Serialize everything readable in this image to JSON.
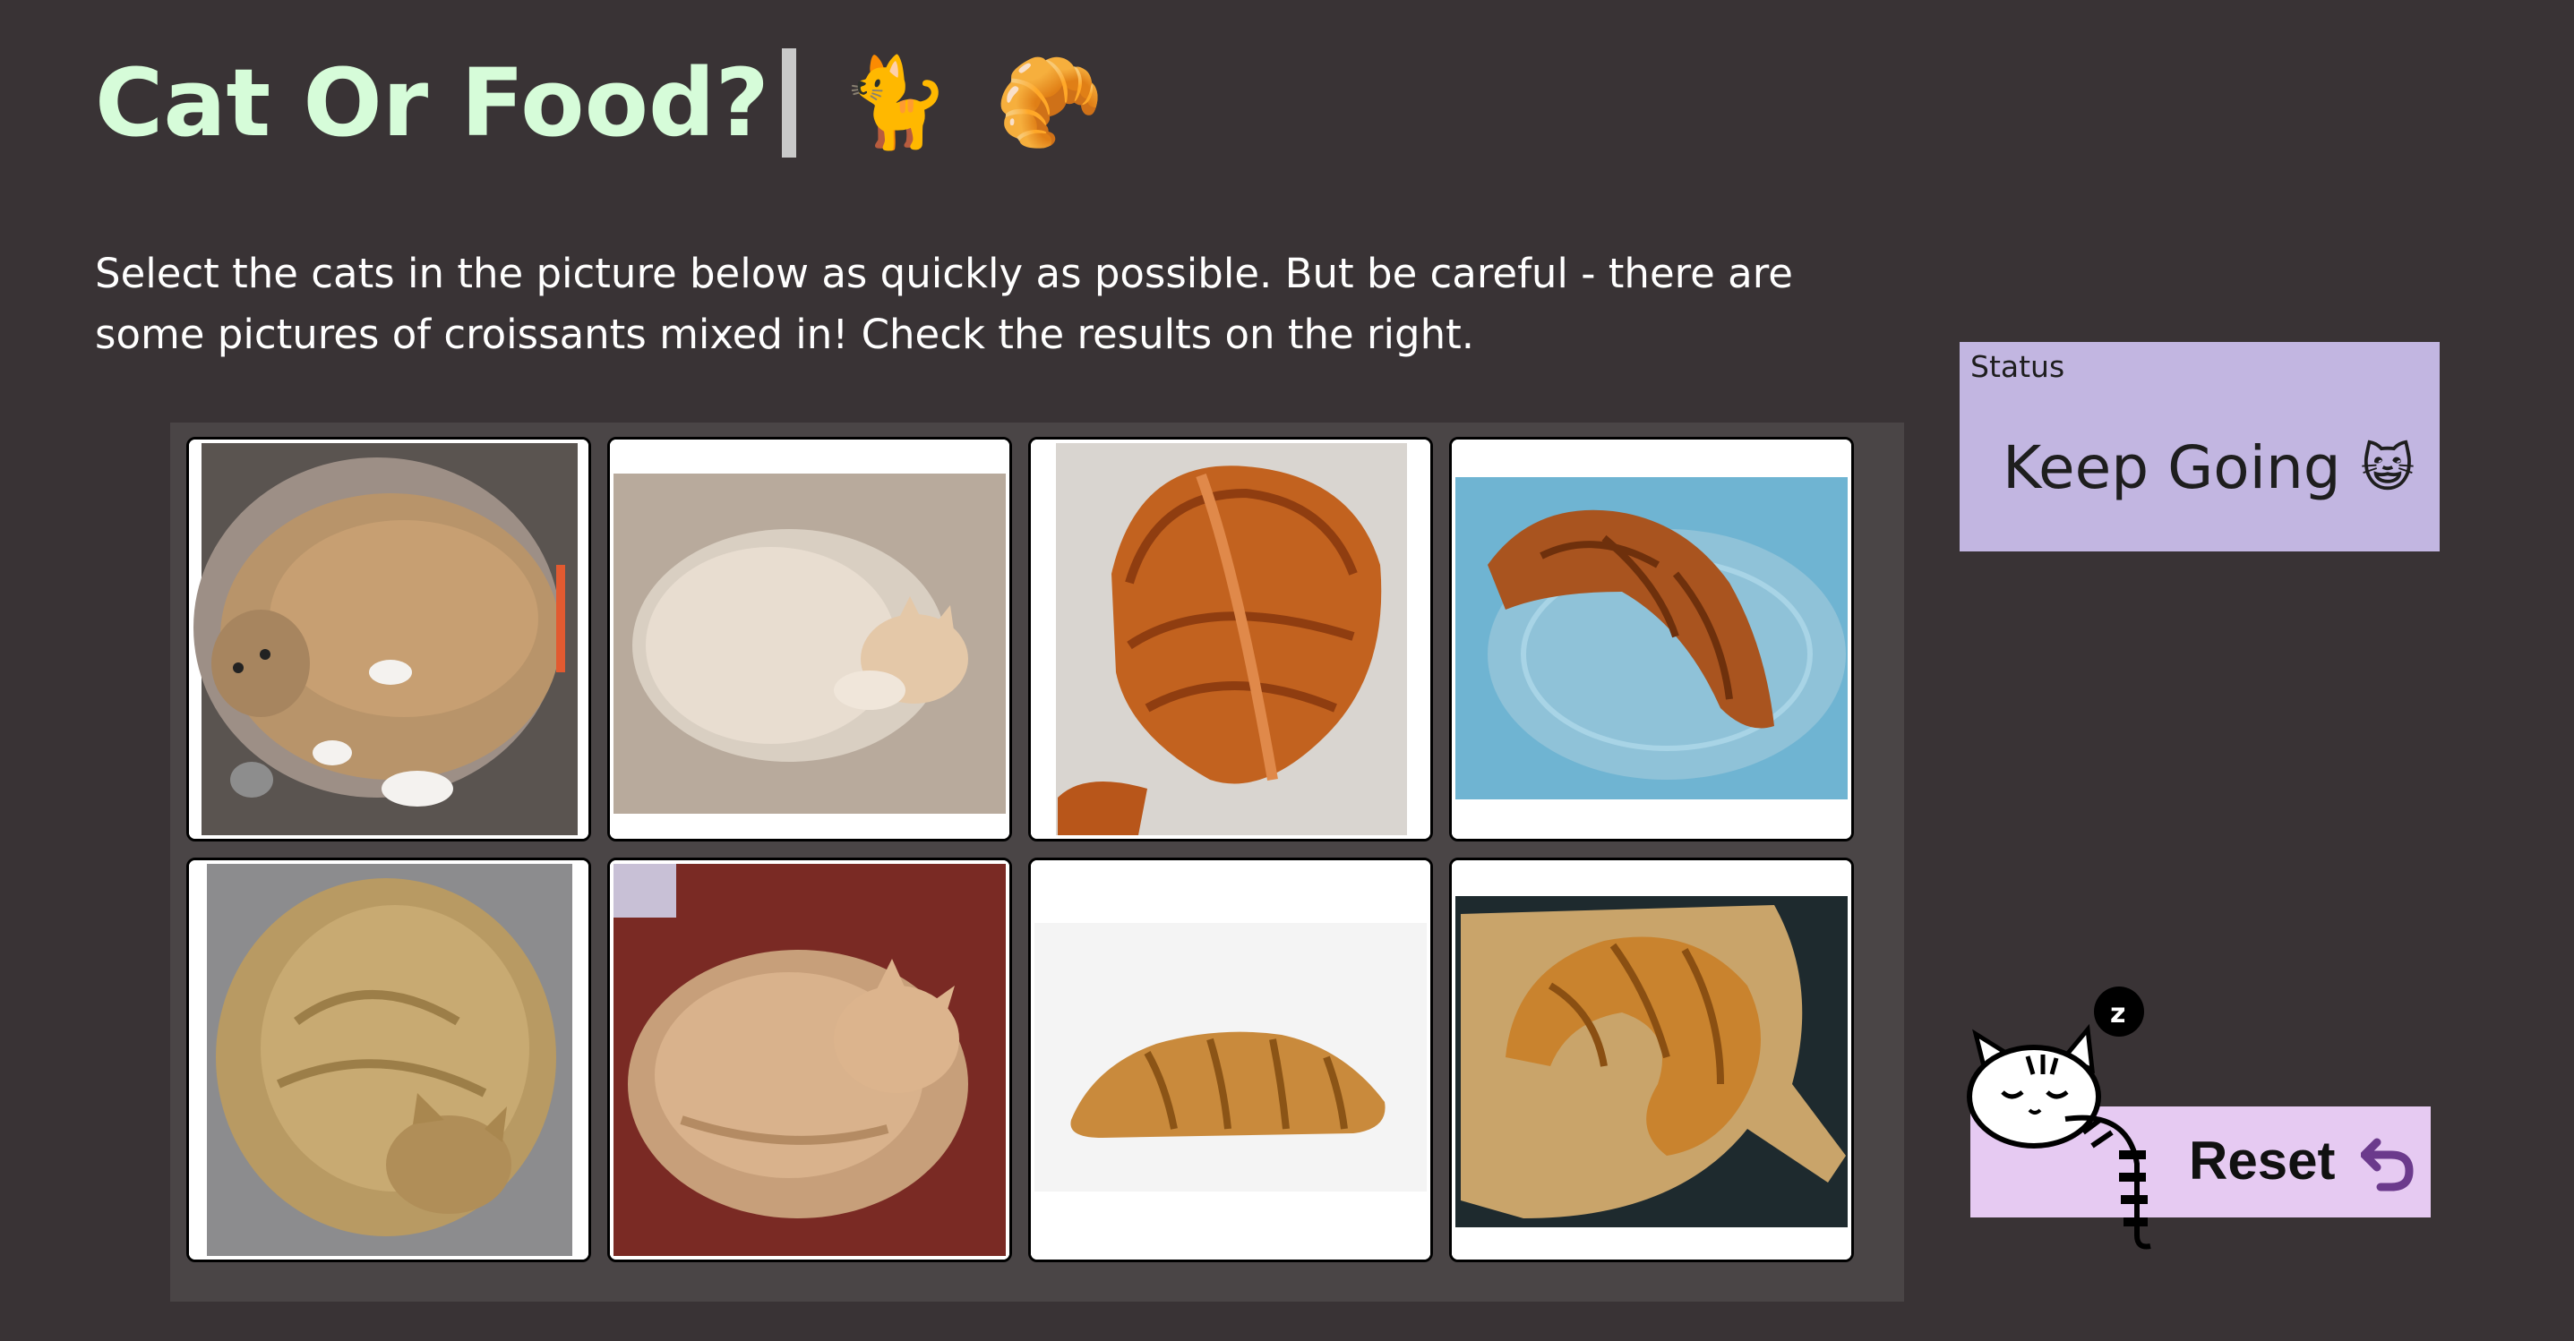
{
  "header": {
    "title": "Cat Or Food?",
    "cat_emoji": "🐈",
    "croissant_emoji": "🥐"
  },
  "instructions": "Select the cats in the picture below as quickly as possible. But be careful - there are some pictures of croissants mixed in! Check the results on the right.",
  "grid": {
    "tiles": [
      {
        "subject": "cat"
      },
      {
        "subject": "cat"
      },
      {
        "subject": "croissant"
      },
      {
        "subject": "croissant"
      },
      {
        "subject": "cat"
      },
      {
        "subject": "cat"
      },
      {
        "subject": "croissant"
      },
      {
        "subject": "croissant"
      }
    ]
  },
  "status": {
    "label": "Status",
    "value": "Keep Going",
    "emoji": "😺"
  },
  "reset": {
    "label": "Reset",
    "sleep_badge": "z"
  },
  "colors": {
    "background": "#393335",
    "title": "#d6fcd9",
    "panel": "#4a4546",
    "status_bg": "#c2b6e1",
    "reset_bg": "#e6caf2",
    "reset_icon": "#6b3a8c"
  }
}
